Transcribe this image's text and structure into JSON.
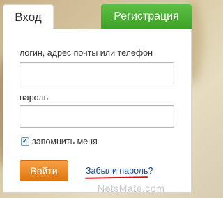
{
  "tabs": {
    "login_label": "Вход",
    "register_label": "Регистрация"
  },
  "form": {
    "login_label": "логин, адрес почты или телефон",
    "login_value": "",
    "password_label": "пароль",
    "password_value": "",
    "remember_label": "запомнить меня",
    "remember_checked": true,
    "submit_label": "Войти",
    "forgot_label": "Забыли пароль?"
  },
  "watermark": "NetsMate.com",
  "colors": {
    "register_green": "#4caf34",
    "submit_orange": "#ee8a24",
    "link_blue": "#1a4a8a",
    "highlight_red": "#d01010"
  }
}
